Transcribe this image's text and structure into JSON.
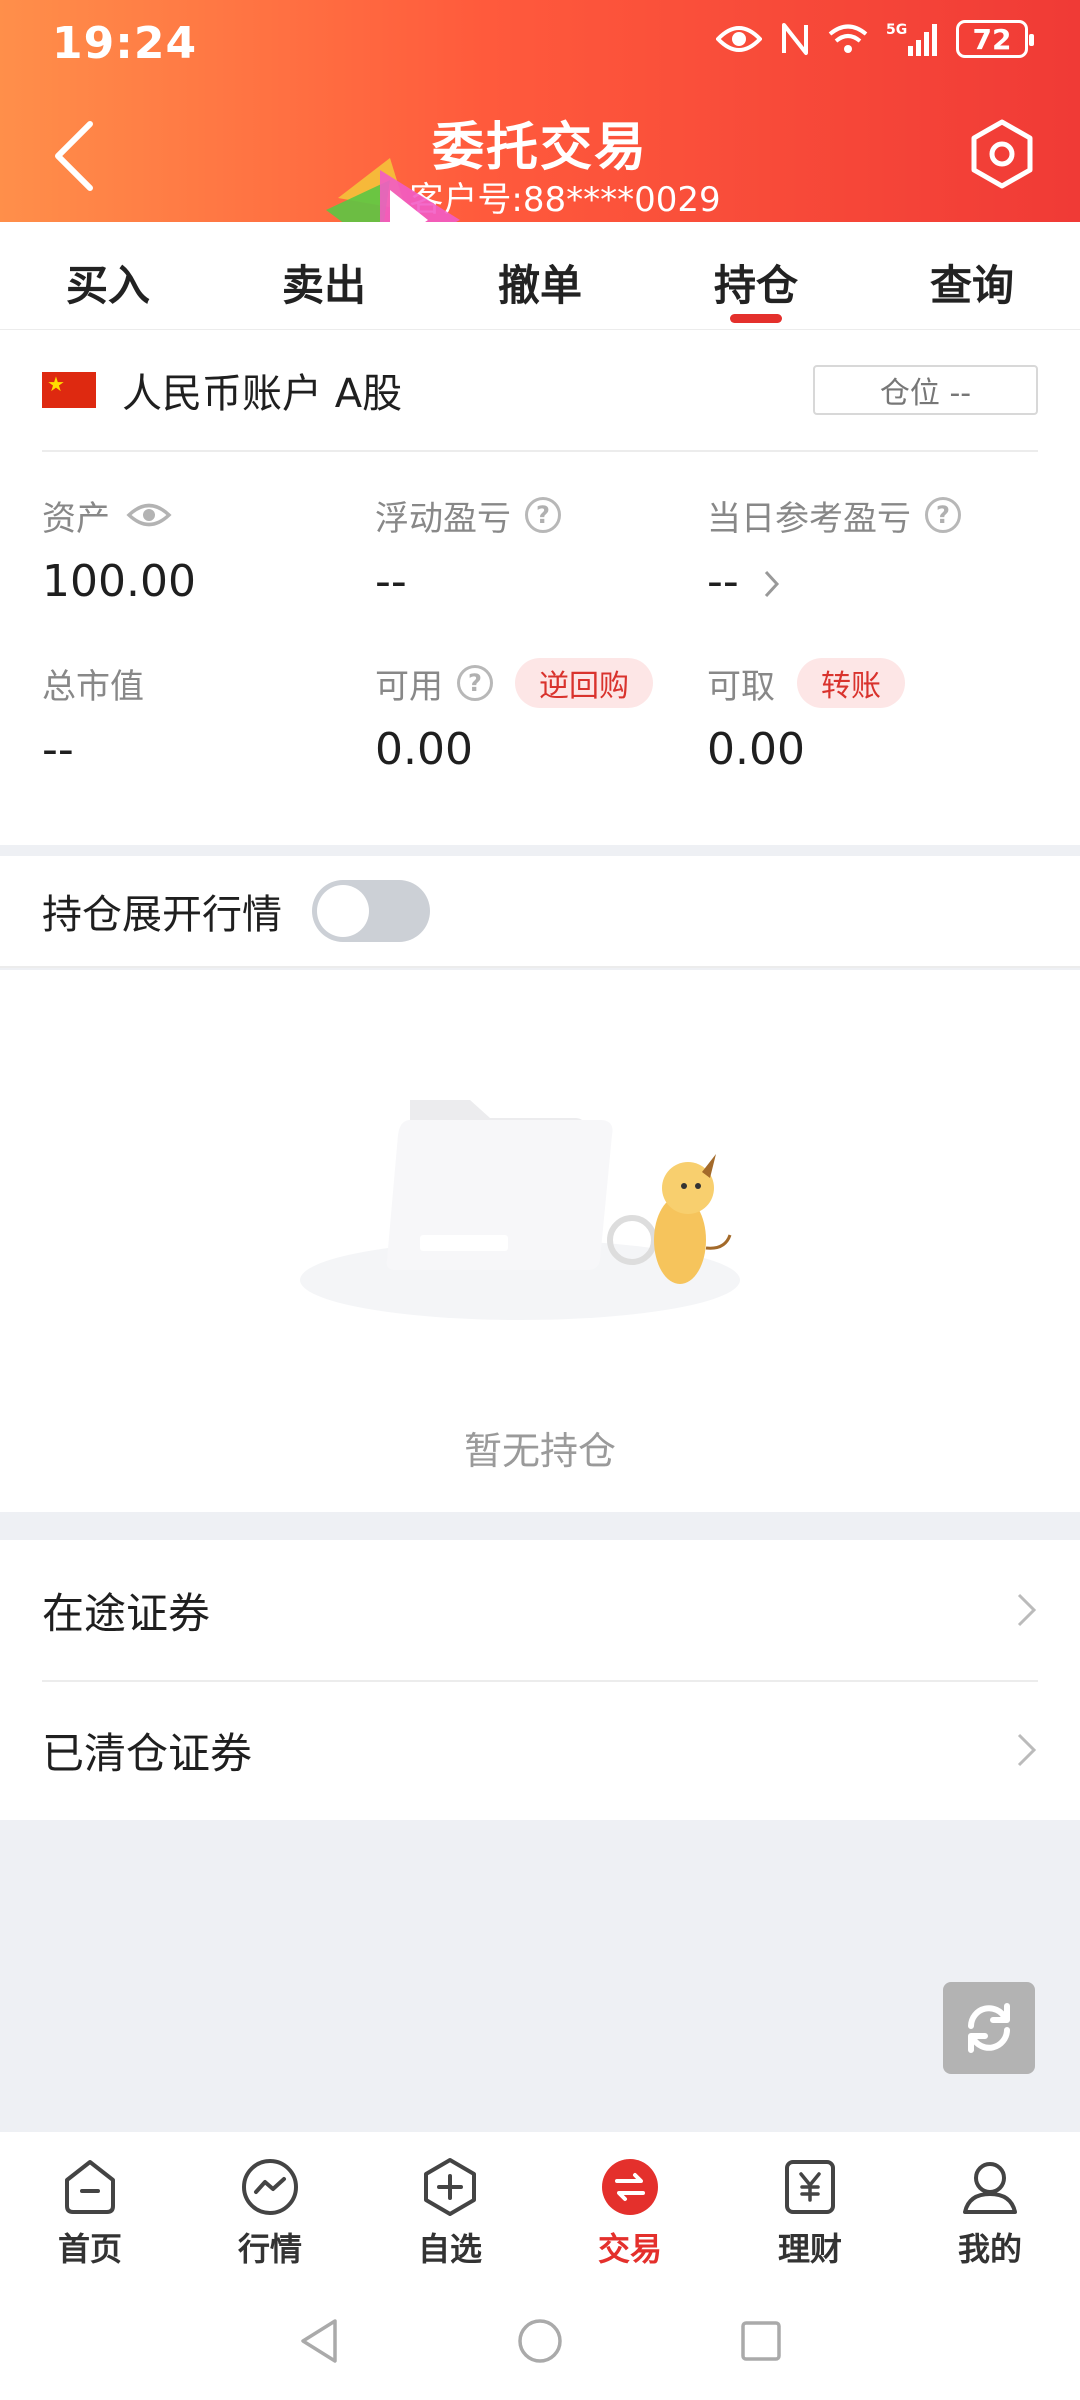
{
  "status_bar": {
    "time": "19:24",
    "battery": "72"
  },
  "header": {
    "title": "委托交易",
    "customer": "客户号:88****0029"
  },
  "tabs": [
    {
      "label": "买入"
    },
    {
      "label": "卖出"
    },
    {
      "label": "撤单"
    },
    {
      "label": "持仓",
      "active": true
    },
    {
      "label": "查询"
    }
  ],
  "account": {
    "name": "人民币账户 A股",
    "position_btn": "仓位 --",
    "metrics": {
      "assets": {
        "label": "资产",
        "value": "100.00"
      },
      "float_pnl": {
        "label": "浮动盈亏",
        "value": "--"
      },
      "today_pnl": {
        "label": "当日参考盈亏",
        "value": "--"
      },
      "market_value": {
        "label": "总市值",
        "value": "--"
      },
      "available": {
        "label": "可用",
        "value": "0.00",
        "tag": "逆回购"
      },
      "withdrawable": {
        "label": "可取",
        "value": "0.00",
        "tag": "转账"
      }
    }
  },
  "toggle": {
    "label": "持仓展开行情",
    "on": false
  },
  "empty_state": {
    "text": "暂无持仓"
  },
  "list": [
    {
      "label": "在途证券"
    },
    {
      "label": "已清仓证券"
    }
  ],
  "bottom_nav": [
    {
      "label": "首页",
      "icon": "home-icon"
    },
    {
      "label": "行情",
      "icon": "market-icon"
    },
    {
      "label": "自选",
      "icon": "watchlist-icon"
    },
    {
      "label": "交易",
      "icon": "trade-icon",
      "active": true
    },
    {
      "label": "理财",
      "icon": "finance-icon"
    },
    {
      "label": "我的",
      "icon": "profile-icon"
    }
  ],
  "colors": {
    "accent": "#e4302c",
    "header_start": "#ff8f4a",
    "header_end": "#f03a36"
  }
}
